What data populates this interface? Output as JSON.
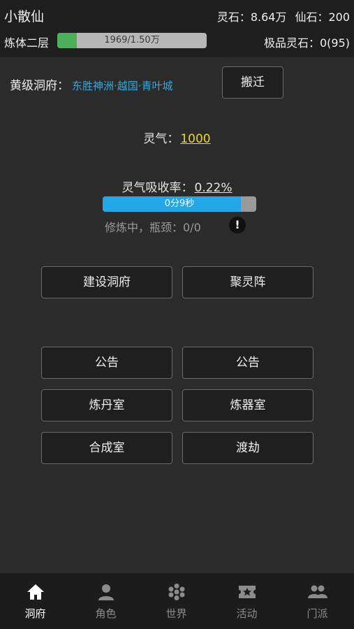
{
  "header": {
    "player_name": "小散仙",
    "spirit_stone": "灵石：8.64万",
    "immortal_stone": "仙石：200",
    "realm": "炼体二层",
    "exp_text": "1969/1.50万",
    "exp_progress": 0.13,
    "premium_stone": "极品灵石：0(95)"
  },
  "cave": {
    "title": "黄级洞府：",
    "location": "东胜神洲·越国·青叶城",
    "move_label": "搬迁"
  },
  "qi": {
    "label": "灵气：",
    "value": "1000"
  },
  "absorb": {
    "label": "灵气吸收率：",
    "rate": "0.22%",
    "timer": "0分9秒",
    "timer_progress": 0.9,
    "status": "修炼中，瓶颈：0/0",
    "info_glyph": "!"
  },
  "buttons": {
    "build": "建设洞府",
    "gather": "聚灵阵",
    "notice1": "公告",
    "notice2": "公告",
    "alchemy": "炼丹室",
    "forge": "炼器室",
    "synth": "合成室",
    "tribulation": "渡劫"
  },
  "tabs": [
    {
      "label": "洞府",
      "icon": "home-icon"
    },
    {
      "label": "角色",
      "icon": "person-icon"
    },
    {
      "label": "世界",
      "icon": "flower-icon"
    },
    {
      "label": "活动",
      "icon": "ticket-icon"
    },
    {
      "label": "门派",
      "icon": "group-icon"
    }
  ],
  "colors": {
    "accent_blue": "#23a7e8",
    "location_blue": "#3aa7d8",
    "qi_yellow": "#e8d838",
    "exp_green": "#4cb05a"
  }
}
